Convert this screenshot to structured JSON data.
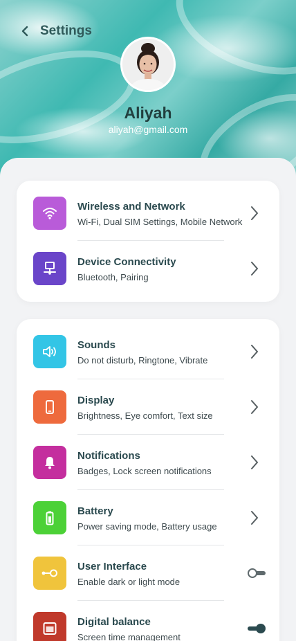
{
  "header": {
    "title": "Settings",
    "back_icon": "chevron-left-icon"
  },
  "profile": {
    "name": "Aliyah",
    "email": "aliyah@gmail.com"
  },
  "groups": [
    {
      "items": [
        {
          "title": "Wireless and Network",
          "subtitle": "Wi-Fi, Dual SIM Settings, Mobile Network",
          "icon": "wifi-icon",
          "color": "#b95bd9",
          "control": "chevron"
        },
        {
          "title": "Device Connectivity",
          "subtitle": "Bluetooth, Pairing",
          "icon": "network-device-icon",
          "color": "#6a45c9",
          "control": "chevron"
        }
      ]
    },
    {
      "items": [
        {
          "title": "Sounds",
          "subtitle": "Do not disturb, Ringtone, Vibrate",
          "icon": "speaker-icon",
          "color": "#33c5e6",
          "control": "chevron"
        },
        {
          "title": "Display",
          "subtitle": "Brightness, Eye comfort, Text size",
          "icon": "phone-icon",
          "color": "#ee6a3d",
          "control": "chevron"
        },
        {
          "title": "Notifications",
          "subtitle": "Badges, Lock screen notifications",
          "icon": "bell-icon",
          "color": "#c42e9e",
          "control": "chevron"
        },
        {
          "title": "Battery",
          "subtitle": "Power saving mode, Battery usage",
          "icon": "battery-icon",
          "color": "#4cd137",
          "control": "chevron"
        },
        {
          "title": "User Interface",
          "subtitle": "Enable dark or light mode",
          "icon": "toggle-key-icon",
          "color": "#f0c43c",
          "control": "toggle",
          "toggle_on": false
        },
        {
          "title": "Digital balance",
          "subtitle": "Screen time management",
          "icon": "window-icon",
          "color": "#c0392b",
          "control": "toggle",
          "toggle_on": true
        }
      ]
    }
  ]
}
